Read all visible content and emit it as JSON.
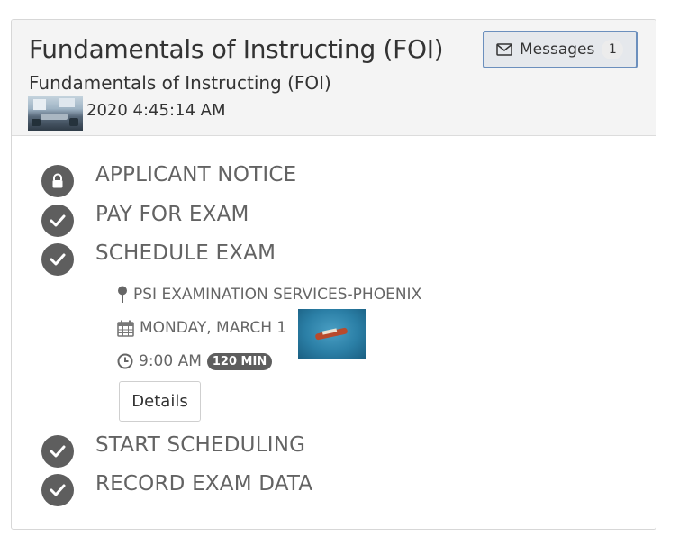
{
  "header": {
    "title": "Fundamentals of Instructing (FOI)",
    "subtitle": "Fundamentals of Instructing (FOI)",
    "date_text": "2020 4:45:14 AM",
    "messages": {
      "label": "Messages",
      "count": "1",
      "icon": "envelope-icon"
    }
  },
  "steps": [
    {
      "label": "APPLICANT NOTICE",
      "icon": "lock-icon"
    },
    {
      "label": "PAY FOR EXAM",
      "icon": "check-icon"
    },
    {
      "label": "SCHEDULE EXAM",
      "icon": "check-icon"
    },
    {
      "label": "START SCHEDULING",
      "icon": "check-icon"
    },
    {
      "label": "RECORD EXAM DATA",
      "icon": "check-icon"
    }
  ],
  "schedule": {
    "location": "PSI EXAMINATION SERVICES-PHOENIX",
    "date": "MONDAY, MARCH 1",
    "time": "9:00 AM",
    "duration": "120 MIN",
    "details_label": "Details"
  },
  "colors": {
    "step_icon": "#5e5e5e",
    "step_text": "#636363",
    "header_bg": "#f4f4f4",
    "button_border": "#6b8fbd"
  }
}
